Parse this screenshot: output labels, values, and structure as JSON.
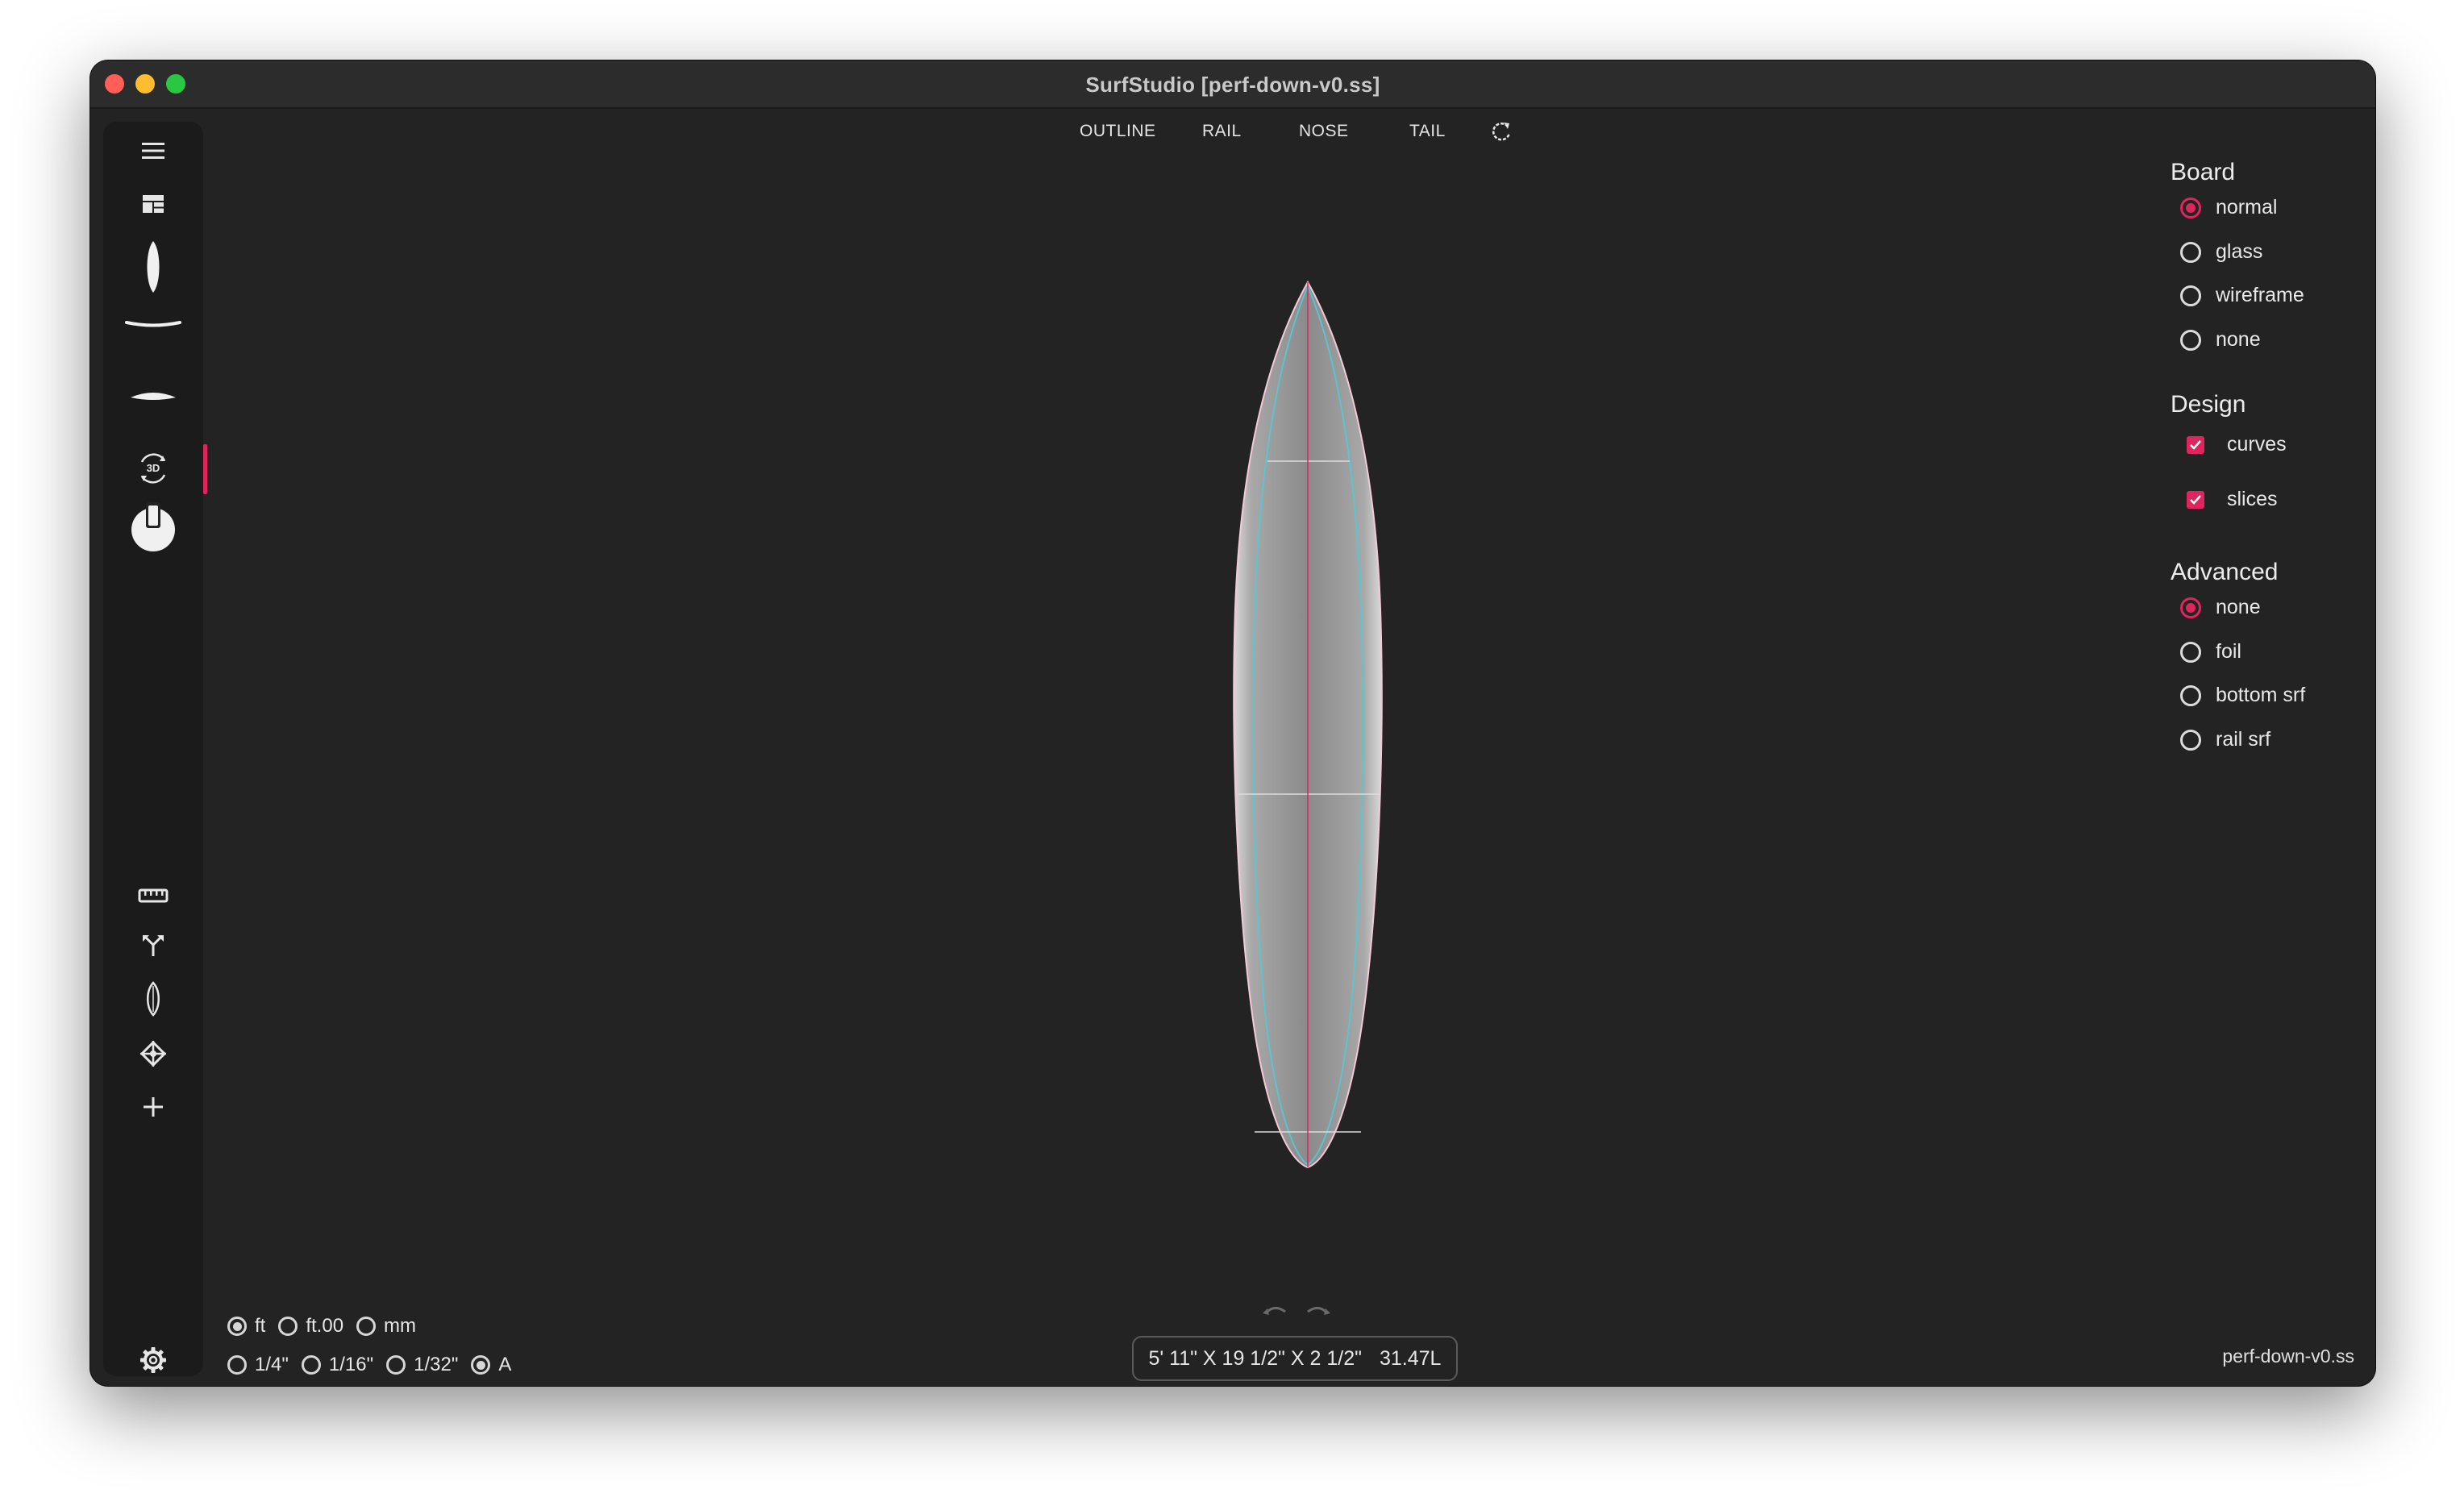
{
  "window": {
    "title": "SurfStudio [perf-down-v0.ss]"
  },
  "toolbar": {
    "tabs": [
      {
        "label": "OUTLINE"
      },
      {
        "label": "RAIL"
      },
      {
        "label": "NOSE"
      },
      {
        "label": "TAIL"
      }
    ],
    "reset_icon": "rotate-icon"
  },
  "sidebar": {
    "top_items": [
      "menu-icon",
      "layout-icon",
      "outline-view-icon",
      "rocker-view-icon",
      "slice-view-icon",
      "3d-view-icon",
      "toggle-icon"
    ],
    "bottom_items": [
      "ruler-icon",
      "split-icon",
      "board-icon",
      "target-icon",
      "add-icon"
    ],
    "settings_icon": "gear-icon",
    "rotate_3d_label": "3D",
    "active_item": "3d-view-icon"
  },
  "panel": {
    "board": {
      "title": "Board",
      "options": [
        {
          "label": "normal",
          "selected": true
        },
        {
          "label": "glass",
          "selected": false
        },
        {
          "label": "wireframe",
          "selected": false
        },
        {
          "label": "none",
          "selected": false
        }
      ]
    },
    "design": {
      "title": "Design",
      "options": [
        {
          "label": "curves",
          "checked": true
        },
        {
          "label": "slices",
          "checked": true
        }
      ]
    },
    "advanced": {
      "title": "Advanced",
      "options": [
        {
          "label": "none",
          "selected": true
        },
        {
          "label": "foil",
          "selected": false
        },
        {
          "label": "bottom srf",
          "selected": false
        },
        {
          "label": "rail srf",
          "selected": false
        }
      ]
    }
  },
  "units": {
    "length": [
      {
        "label": "ft",
        "selected": true
      },
      {
        "label": "ft.00",
        "selected": false
      },
      {
        "label": "mm",
        "selected": false
      }
    ],
    "precision": [
      {
        "label": "1/4\"",
        "selected": false
      },
      {
        "label": "1/16\"",
        "selected": false
      },
      {
        "label": "1/32\"",
        "selected": false
      },
      {
        "label": "A",
        "selected": true
      }
    ]
  },
  "status": {
    "dimensions": "5' 11\" X 19 1/2\" X 2 1/2\"",
    "volume": "31.47L",
    "filename": "perf-down-v0.ss"
  },
  "colors": {
    "accent": "#e0245e",
    "background": "#232323",
    "sidebar": "#1b1b1b",
    "curve_cyan": "#55c8d6"
  }
}
